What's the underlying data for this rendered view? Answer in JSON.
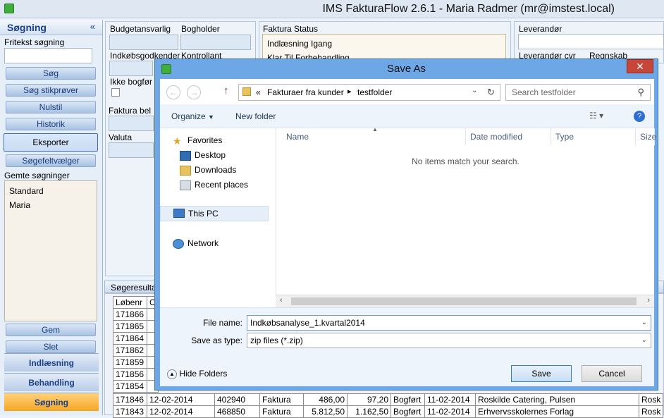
{
  "app": {
    "title": "IMS FakturaFlow 2.6.1 - Maria Radmer (mr@imstest.local)"
  },
  "left": {
    "header": "Søgning",
    "collapse": "«",
    "freetext_label": "Fritekst søgning",
    "buttons": [
      "Søg",
      "Søg stikprøver",
      "Nulstil",
      "Historik",
      "Eksporter",
      "Søgefeltvælger"
    ],
    "saved_label": "Gemte søgninger",
    "saved": [
      "Standard",
      "Maria"
    ],
    "bottom": [
      "Gem",
      "Slet"
    ],
    "modules": [
      "Indlæsning",
      "Behandling",
      "Søgning"
    ]
  },
  "filters": {
    "budget": "Budgetansvarlig",
    "bogholder": "Bogholder",
    "indkob": "Indkøbsgodkender",
    "kontrollant": "Kontrollant",
    "ikke_bogf": "Ikke bogfør",
    "faktura_bel": "Faktura bel",
    "valuta": "Valuta",
    "status_label": "Faktura Status",
    "status_items": [
      "Indlæsning Igang",
      "Klar Til Forbehandling"
    ],
    "leverandor": "Leverandør",
    "lev_cvr": "Leverandør cvr",
    "regnskab": "Regnskab"
  },
  "grid": {
    "header": "Søgeresulta",
    "col1": "Løbenr",
    "col2": "C",
    "ids": [
      "171866",
      "171865",
      "171864",
      "171862",
      "171859",
      "171856",
      "171854"
    ],
    "rows": [
      [
        "171846",
        "12-02-2014",
        "402940",
        "Faktura",
        "486,00",
        "97,20",
        "Bogført",
        "11-02-2014",
        "Roskilde Catering, Pulsen",
        "Rosk"
      ],
      [
        "171843",
        "12-02-2014",
        "468850",
        "Faktura",
        "5.812,50",
        "1.162,50",
        "Bogført",
        "11-02-2014",
        "Erhvervsskolernes Forlag",
        "Rosk"
      ]
    ]
  },
  "dialog": {
    "title": "Save As",
    "close": "✕",
    "path_prefix": "«",
    "path1": "Fakturaer fra kunder",
    "path2": "testfolder",
    "search_placeholder": "Search testfolder",
    "organize": "Organize",
    "new_folder": "New folder",
    "nav": {
      "favorites": "Favorites",
      "desktop": "Desktop",
      "downloads": "Downloads",
      "recent": "Recent places",
      "thispc": "This PC",
      "network": "Network"
    },
    "columns": [
      "Name",
      "Date modified",
      "Type",
      "Size"
    ],
    "empty": "No items match your search.",
    "filename_label": "File name:",
    "filename": "Indkøbsanalyse_1.kvartal2014",
    "savetype_label": "Save as type:",
    "savetype": "zip files (*.zip)",
    "hide_folders": "Hide Folders",
    "save": "Save",
    "cancel": "Cancel"
  }
}
